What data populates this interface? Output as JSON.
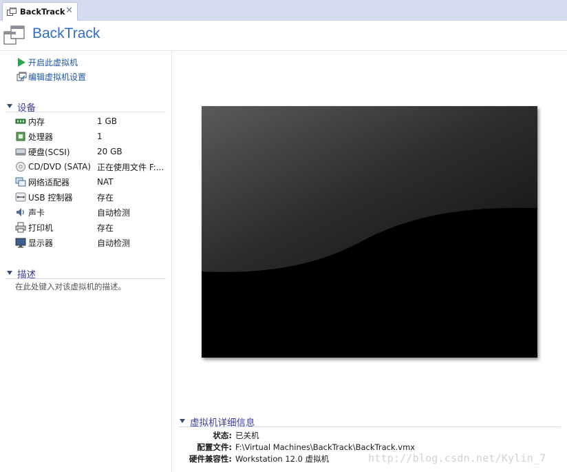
{
  "tab": {
    "label": "BackTrack",
    "close_glyph": "✕"
  },
  "header": {
    "title": "BackTrack"
  },
  "actions": [
    {
      "label": "开启此虚拟机",
      "icon": "play-icon"
    },
    {
      "label": "编辑虚拟机设置",
      "icon": "edit-settings-icon"
    }
  ],
  "devices_section": {
    "title": "设备",
    "items": [
      {
        "name": "内存",
        "value": "1 GB",
        "icon": "memory-icon"
      },
      {
        "name": "处理器",
        "value": "1",
        "icon": "processor-icon"
      },
      {
        "name": "硬盘(SCSI)",
        "value": "20 GB",
        "icon": "hard-disk-icon"
      },
      {
        "name": "CD/DVD (SATA)",
        "value": "正在使用文件 F:...",
        "icon": "cd-dvd-icon"
      },
      {
        "name": "网络适配器",
        "value": "NAT",
        "icon": "network-adapter-icon"
      },
      {
        "name": "USB 控制器",
        "value": "存在",
        "icon": "usb-icon"
      },
      {
        "name": "声卡",
        "value": "自动检测",
        "icon": "sound-card-icon"
      },
      {
        "name": "打印机",
        "value": "存在",
        "icon": "printer-icon"
      },
      {
        "name": "显示器",
        "value": "自动检测",
        "icon": "display-icon"
      }
    ]
  },
  "description_section": {
    "title": "描述",
    "placeholder": "在此处键入对该虚拟机的描述。"
  },
  "details_section": {
    "title": "虚拟机详细信息",
    "rows": [
      {
        "key": "状态:",
        "value": "已关机"
      },
      {
        "key": "配置文件:",
        "value": "F:\\Virtual Machines\\BackTrack\\BackTrack.vmx"
      },
      {
        "key": "硬件兼容性:",
        "value": "Workstation 12.0 虚拟机"
      }
    ]
  },
  "watermark": "http://blog.csdn.net/Kylin_7",
  "colors": {
    "title_blue": "#2f6fc4",
    "link_blue": "#1f55a8",
    "section_purple": "#3b3e9b",
    "tabstrip_bg": "#d6dcef",
    "play_green": "#2ea44f"
  }
}
